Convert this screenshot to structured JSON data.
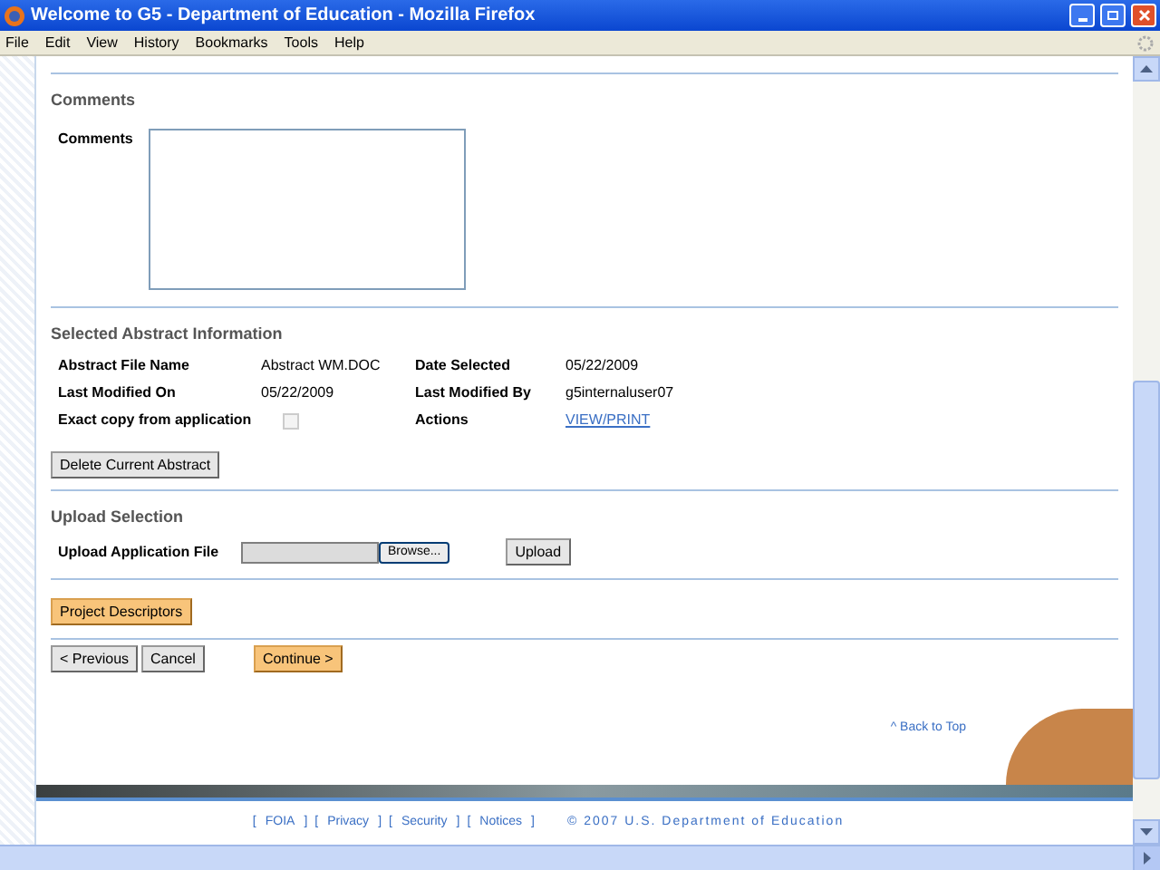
{
  "window": {
    "title": "Welcome to G5 - Department of Education - Mozilla Firefox"
  },
  "menu": [
    "File",
    "Edit",
    "View",
    "History",
    "Bookmarks",
    "Tools",
    "Help"
  ],
  "comments": {
    "heading": "Comments",
    "label": "Comments"
  },
  "abstract": {
    "heading": "Selected Abstract Information",
    "rows": [
      {
        "label1": "Abstract File Name",
        "value1": "Abstract WM.DOC",
        "label2": "Date Selected",
        "value2": "05/22/2009"
      },
      {
        "label1": "Last Modified On",
        "value1": "05/22/2009",
        "label2": "Last Modified By",
        "value2": "g5internaluser07"
      }
    ],
    "exact_copy": {
      "label": "Exact copy from application",
      "checked": false,
      "disabled": true
    },
    "actions": {
      "label": "Actions",
      "link": "VIEW/PRINT"
    },
    "delete_button": "Delete Current Abstract"
  },
  "upload": {
    "heading": "Upload Selection",
    "label": "Upload Application File",
    "browse": "Browse...",
    "button": "Upload"
  },
  "descriptors_button": "Project Descriptors",
  "nav": {
    "previous": "< Previous",
    "cancel": "Cancel",
    "continue": "Continue >"
  },
  "back_to_top": "^ Back to Top",
  "footer": {
    "links": [
      {
        "open": "[",
        "label": "FOIA",
        "close": "]"
      },
      {
        "open": "[",
        "label": "Privacy",
        "close": "]"
      },
      {
        "open": "[",
        "label": "Security",
        "close": "]"
      },
      {
        "open": "[",
        "label": "Notices",
        "close": "]"
      }
    ],
    "copyright": "© 2007 U.S. Department of Education"
  }
}
